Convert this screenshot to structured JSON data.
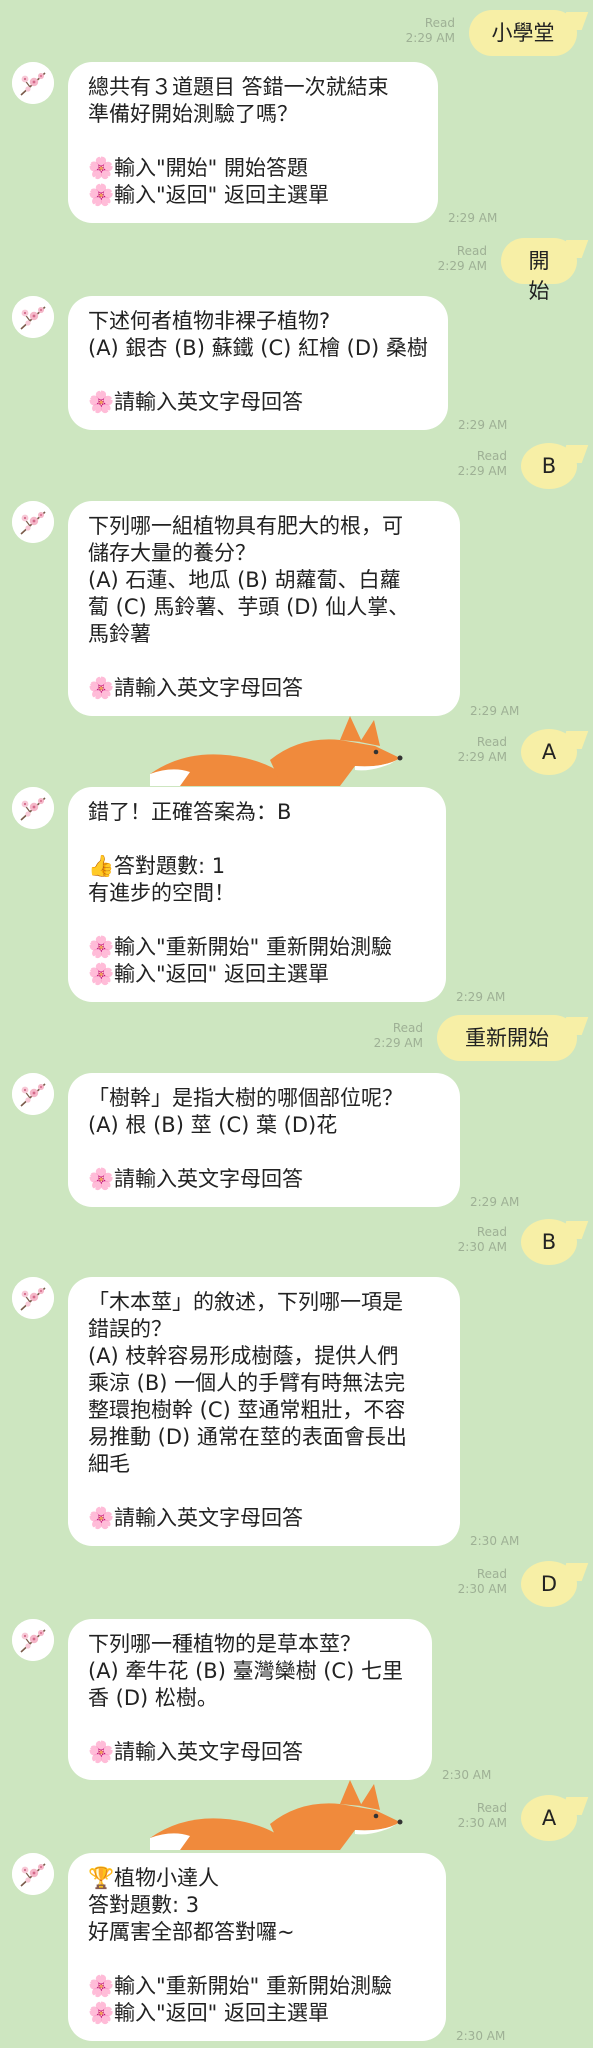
{
  "messages": [
    {
      "id": "m1",
      "side": "out",
      "text": "小學堂",
      "read": "Read",
      "time": "2:29 AM"
    },
    {
      "id": "m2",
      "side": "in",
      "lines": [
        "總共有３道題目 答錯一次就結束",
        "準備好開始測驗了嗎？",
        "",
        "🌸輸入\"開始\" 開始答題",
        "🌸輸入\"返回\" 返回主選單"
      ],
      "time": "2:29 AM"
    },
    {
      "id": "m3",
      "side": "out",
      "text": "開始",
      "read": "Read",
      "time": "2:29 AM"
    },
    {
      "id": "m4",
      "side": "in",
      "lines": [
        "下述何者植物非裸子植物?",
        "(A) 銀杏 (B) 蘇鐵 (C) 紅檜 (D) 桑樹",
        "",
        "🌸請輸入英文字母回答"
      ],
      "time": "2:29 AM"
    },
    {
      "id": "m5",
      "side": "out",
      "text": "B",
      "read": "Read",
      "time": "2:29 AM"
    },
    {
      "id": "m6",
      "side": "in",
      "lines": [
        "下列哪一組植物具有肥大的根，可",
        "儲存大量的養分？",
        "(A) 石蓮、地瓜 (B) 胡蘿蔔、白蘿",
        "蔔 (C) 馬鈴薯、芋頭 (D) 仙人掌、",
        "馬鈴薯",
        "",
        "🌸請輸入英文字母回答"
      ],
      "time": "2:29 AM"
    },
    {
      "id": "m7",
      "side": "out",
      "text": "A",
      "read": "Read",
      "time": "2:29 AM"
    },
    {
      "id": "m8",
      "side": "in",
      "lines": [
        "錯了！正確答案為：B",
        "",
        "👍答對題數: 1",
        "有進步的空間！",
        "",
        "🌸輸入\"重新開始\" 重新開始測驗",
        "🌸輸入\"返回\" 返回主選單"
      ],
      "time": "2:29 AM"
    },
    {
      "id": "m9",
      "side": "out",
      "text": "重新開始",
      "read": "Read",
      "time": "2:29 AM"
    },
    {
      "id": "m10",
      "side": "in",
      "lines": [
        "「樹幹」是指大樹的哪個部位呢？",
        "(A) 根 (B) 莖 (C) 葉 (D)花",
        "",
        "🌸請輸入英文字母回答"
      ],
      "time": "2:29 AM"
    },
    {
      "id": "m11",
      "side": "out",
      "text": "B",
      "read": "Read",
      "time": "2:30 AM"
    },
    {
      "id": "m12",
      "side": "in",
      "lines": [
        "「木本莖」的敘述，下列哪一項是",
        "錯誤的？",
        "(A) 枝幹容易形成樹蔭，提供人們",
        "乘涼 (B) 一個人的手臂有時無法完",
        "整環抱樹幹 (C) 莖通常粗壯，不容",
        "易推動 (D) 通常在莖的表面會長出",
        "細毛",
        "",
        "🌸請輸入英文字母回答"
      ],
      "time": "2:30 AM"
    },
    {
      "id": "m13",
      "side": "out",
      "text": "D",
      "read": "Read",
      "time": "2:30 AM"
    },
    {
      "id": "m14",
      "side": "in",
      "lines": [
        "下列哪一種植物的是草本莖？",
        "(A) 牽牛花 (B) 臺灣欒樹 (C) 七里",
        "香 (D) 松樹。",
        "",
        "🌸請輸入英文字母回答"
      ],
      "time": "2:30 AM"
    },
    {
      "id": "m15",
      "side": "out",
      "text": "A",
      "read": "Read",
      "time": "2:30 AM"
    },
    {
      "id": "m16",
      "side": "in",
      "lines": [
        "🏆植物小達人",
        "答對題數: 3",
        "好厲害全部都答對囉~",
        "",
        "🌸輸入\"重新開始\" 重新開始測驗",
        "🌸輸入\"返回\" 返回主選單"
      ],
      "time": "2:30 AM"
    }
  ],
  "icons": {
    "avatar": "cherry-blossom-branch-avatar-icon",
    "sticker": "fox-sticker",
    "flower": "cherry-blossom-emoji",
    "thumbs": "thumbs-up-emoji",
    "trophy": "trophy-emoji"
  },
  "colors": {
    "background": "#cde6c0",
    "bubble_in": "#ffffff",
    "bubble_out": "#f7efa6",
    "meta_text": "#9eb095",
    "fox": "#f08a3c"
  }
}
